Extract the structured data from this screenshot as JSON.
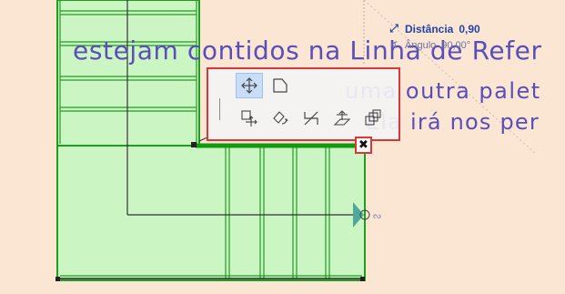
{
  "subtitles": {
    "line1": "estejam contidos na Linha de Refer",
    "line2": "uma outra palet",
    "line3": "Ela irá nos per"
  },
  "tracker": {
    "distance_icon": "diagonal-arrow-icon",
    "distance_label": "Distância",
    "distance_value": "0,90",
    "angle_icon": "angle-icon",
    "angle_label": "Ângulo",
    "angle_value": "90,00°"
  },
  "pet_palette": {
    "buttons": [
      {
        "name": "drag-icon",
        "active": true
      },
      {
        "name": "offset-edge-icon",
        "active": false
      },
      {
        "name": "drag-copy-icon",
        "active": false
      },
      {
        "name": "rotate-icon",
        "active": false
      },
      {
        "name": "stretch-icon",
        "active": false
      },
      {
        "name": "elevate-icon",
        "active": false
      },
      {
        "name": "multiply-icon",
        "active": false
      }
    ]
  },
  "hotspot": {
    "symbol": "✖"
  },
  "colors": {
    "background": "#fbe5d3",
    "stair_fill": "#ccf5c4",
    "stair_line": "#1f9e1f",
    "highlight": "#d83838",
    "subtitle": "#5a4fb8",
    "tracker_text": "#2244aa"
  }
}
